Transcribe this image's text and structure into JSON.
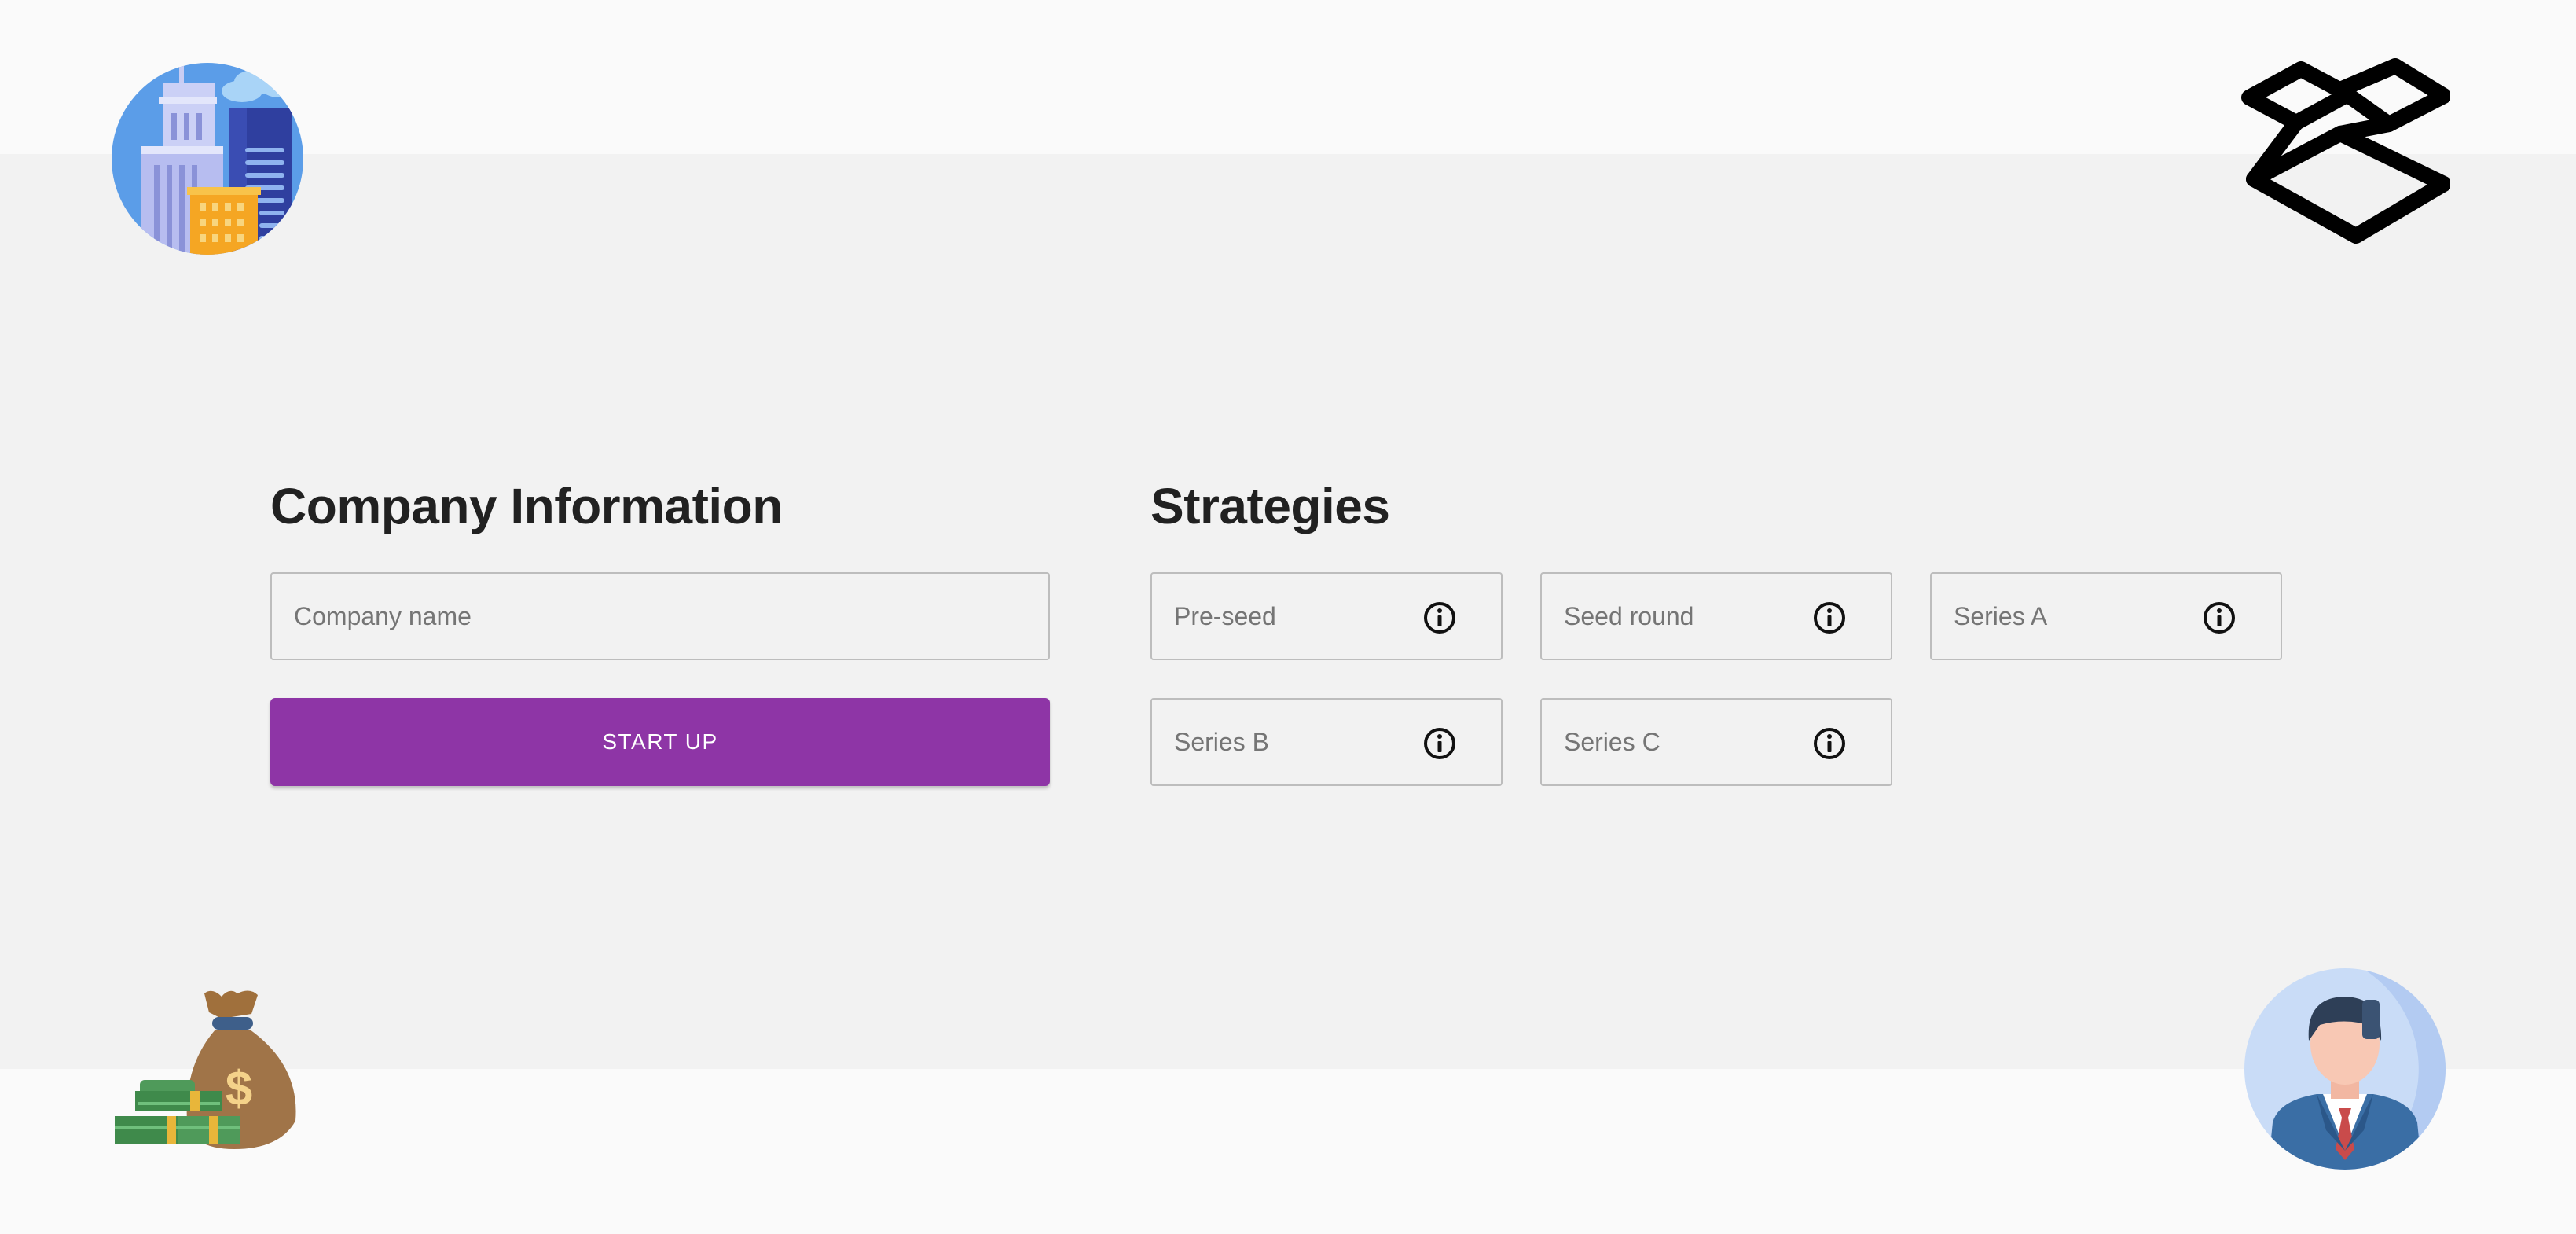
{
  "company_section": {
    "title": "Company Information",
    "company_name_placeholder": "Company name",
    "company_name_value": "",
    "start_button_label": "START UP",
    "accent_color": "#8e35a6"
  },
  "strategies_section": {
    "title": "Strategies",
    "options": [
      {
        "placeholder": "Pre-seed",
        "value": "",
        "icon": "info-icon"
      },
      {
        "placeholder": "Seed round",
        "value": "",
        "icon": "info-icon"
      },
      {
        "placeholder": "Series A",
        "value": "",
        "icon": "info-icon"
      },
      {
        "placeholder": "Series B",
        "value": "",
        "icon": "info-icon"
      },
      {
        "placeholder": "Series C",
        "value": "",
        "icon": "info-icon"
      }
    ]
  },
  "decorations": {
    "top_left": "city-buildings-icon",
    "top_right": "layered-boxes-logo-icon",
    "bottom_left": "money-bag-cash-icon",
    "bottom_right": "businessman-avatar-icon"
  }
}
